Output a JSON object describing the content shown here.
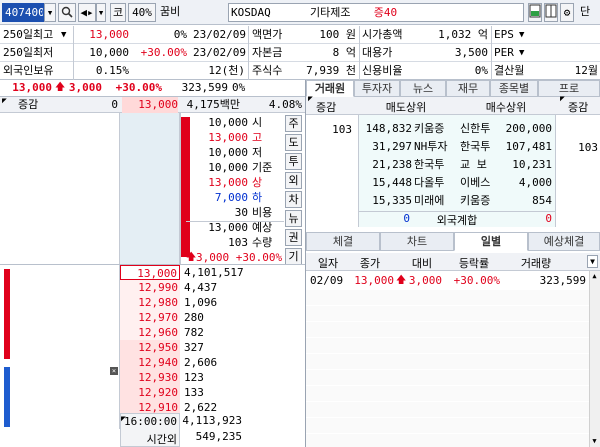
{
  "toolbar": {
    "code": "407400",
    "prefix_label": "코",
    "percent_label": "40%",
    "stock_name": "꿈비",
    "market": "KOSDAQ",
    "industry": "기타제조",
    "margin_label": "증40",
    "tail_label": "단"
  },
  "info": {
    "r1": {
      "l1": "250일최고",
      "v1": "13,000",
      "p1": "0%",
      "d1": "23/02/09",
      "l2": "액면가",
      "v2": "100 원",
      "l3": "시가총액",
      "v3": "1,032 억",
      "l4": "EPS"
    },
    "r2": {
      "l1": "250일최저",
      "v1": "10,000",
      "p1": "+30.00%",
      "d1": "23/02/09",
      "l2": "자본금",
      "v2": "8 억",
      "l3": "대용가",
      "v3": "3,500",
      "l4": "PER"
    },
    "r3": {
      "l1": "외국인보유",
      "v1": "0.15%",
      "p1": "12(천)",
      "l2": "주식수",
      "v2": "7,939 천",
      "l3": "신용비율",
      "v3": "0%",
      "l4": "결산월",
      "v4": "12월"
    }
  },
  "pricebar": {
    "price": "13,000",
    "change": "3,000",
    "rate": "+30.00%",
    "volume": "323,599",
    "vol_rate": "0%"
  },
  "ob_header": {
    "label": "증감",
    "val": "0",
    "price": "13,000",
    "amount": "4,175백만",
    "rate": "4.08%"
  },
  "summary": [
    {
      "value": "10,000",
      "label": "시",
      "color": "#000"
    },
    {
      "value": "13,000",
      "label": "고",
      "color": "#e0001b"
    },
    {
      "value": "10,000",
      "label": "저",
      "color": "#000"
    },
    {
      "value": "10,000",
      "label": "기준",
      "color": "#000"
    },
    {
      "value": "13,000",
      "label": "상",
      "color": "#e0001b"
    },
    {
      "value": "7,000",
      "label": "하",
      "color": "#0030d0"
    },
    {
      "value": "30",
      "label": "비용",
      "color": "#000"
    },
    {
      "value": "13,000",
      "label": "예상",
      "color": "#000"
    },
    {
      "value": "103",
      "label": "수량",
      "color": "#000"
    },
    {
      "value": "3,000 +30.00%",
      "label": "",
      "color": "#e0001b"
    }
  ],
  "side_buttons": [
    "주",
    "도",
    "투",
    "외",
    "차",
    "뉴",
    "권",
    "기"
  ],
  "asks": [
    {
      "price": "13,000",
      "qty": "4,101,517",
      "color": "#e0001b"
    },
    {
      "price": "12,990",
      "qty": "4,437",
      "color": "#e0001b"
    },
    {
      "price": "12,980",
      "qty": "1,096",
      "color": "#e0001b"
    },
    {
      "price": "12,970",
      "qty": "280",
      "color": "#e0001b"
    },
    {
      "price": "12,960",
      "qty": "782",
      "color": "#e0001b"
    },
    {
      "price": "12,950",
      "qty": "327",
      "color": "#e0001b"
    },
    {
      "price": "12,940",
      "qty": "2,606",
      "color": "#e0001b"
    },
    {
      "price": "12,930",
      "qty": "123",
      "color": "#e0001b"
    },
    {
      "price": "12,920",
      "qty": "133",
      "color": "#e0001b"
    },
    {
      "price": "12,910",
      "qty": "2,622",
      "color": "#e0001b"
    }
  ],
  "ob_footer": {
    "time": "16:00:00",
    "total": "4,113,923",
    "after_label": "시간외",
    "after_val": "549,235"
  },
  "trader_tabs": [
    "거래원",
    "투자자",
    "뉴스",
    "재무",
    "종목별",
    "프로"
  ],
  "trader": {
    "left_label": "증감",
    "right_label": "증감",
    "sell_header": "매도상위",
    "buy_header": "매수상위",
    "left_change": "103",
    "right_change": "103",
    "rows": [
      {
        "sq": "148,832",
        "sn": "키움증",
        "bn": "신한투",
        "bq": "200,000"
      },
      {
        "sq": "31,297",
        "sn": "NH투자",
        "bn": "한국투",
        "bq": "107,481"
      },
      {
        "sq": "21,238",
        "sn": "한국투",
        "bn": "교 보",
        "bq": "10,231"
      },
      {
        "sq": "15,448",
        "sn": "다올투",
        "bn": "이베스",
        "bq": "4,000"
      },
      {
        "sq": "15,335",
        "sn": "미래에",
        "bn": "키움증",
        "bq": "854"
      }
    ],
    "foreign_sum_left": "0",
    "foreign_sum_label": "외국계합",
    "foreign_sum_right": "0"
  },
  "bottom_tabs": [
    "체결",
    "차트",
    "일별",
    "예상체결"
  ],
  "daily": {
    "headers": [
      "일자",
      "종가",
      "대비",
      "등락률",
      "거래량"
    ],
    "rows": [
      {
        "date": "02/09",
        "close": "13,000",
        "change": "3,000",
        "rate": "+30.00%",
        "volume": "323,599"
      }
    ]
  }
}
